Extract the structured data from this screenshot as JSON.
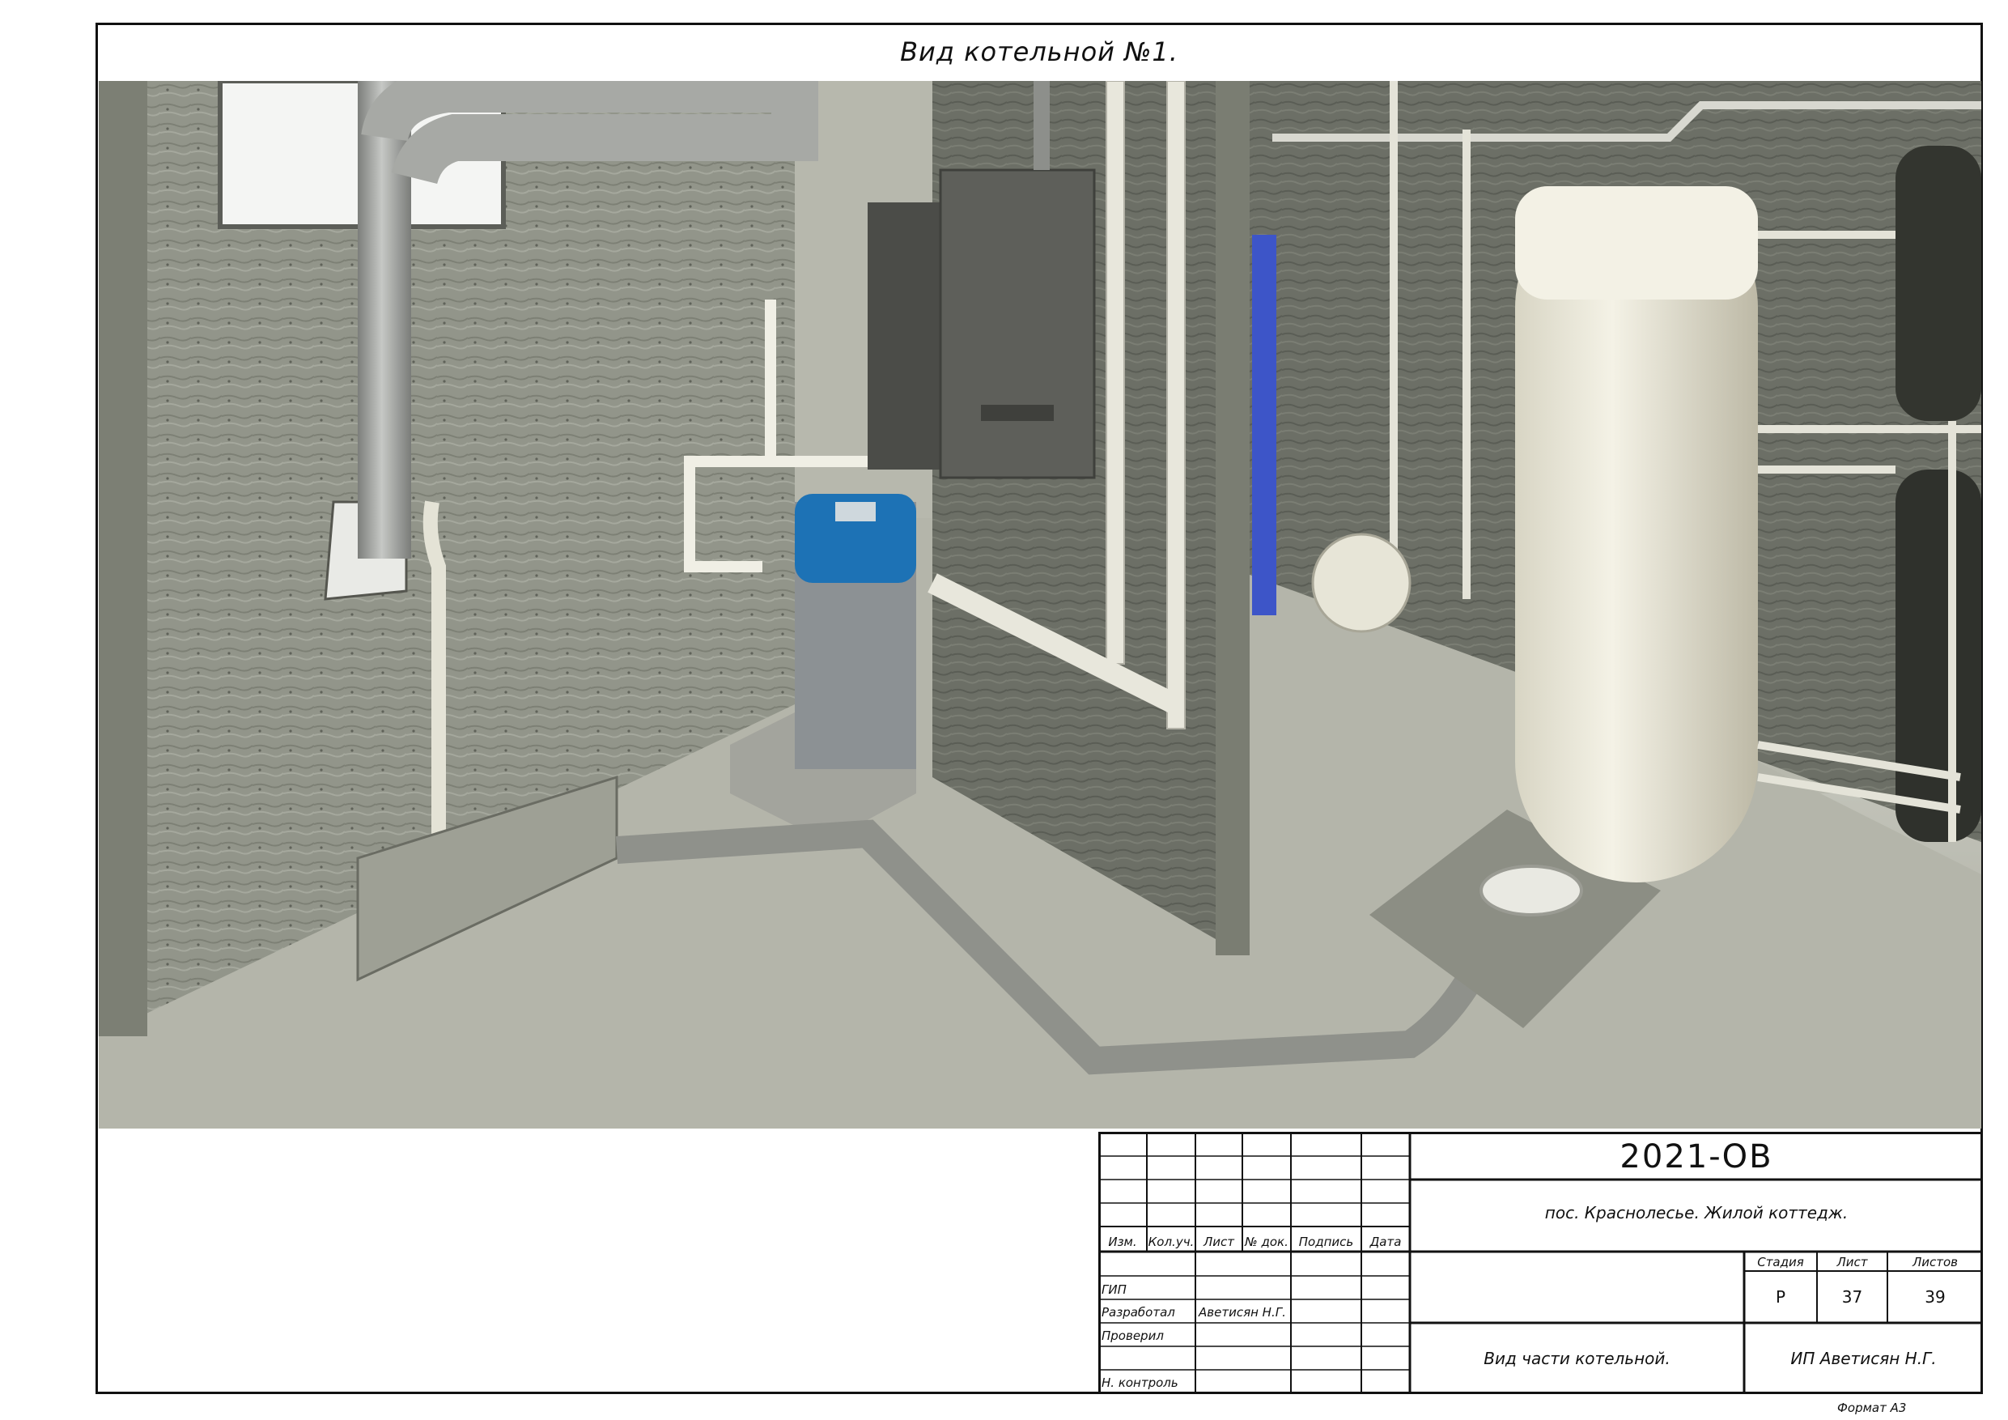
{
  "sheet": {
    "title": "Вид котельной №1.",
    "format_label": "Формат А3"
  },
  "stamp": {
    "document_code": "2021-ОВ",
    "project_name": "пос. Краснолесье. Жилой коттедж.",
    "drawing_name": "Вид части котельной.",
    "organization": "ИП Аветисян Н.Г.",
    "revision_headers": [
      "Изм.",
      "Кол.уч.",
      "Лист",
      "№ док.",
      "Подпись",
      "Дата"
    ],
    "roles": [
      {
        "role": "ГИП",
        "name": ""
      },
      {
        "role": "Разработал",
        "name": "Аветисян Н.Г."
      },
      {
        "role": "Проверил",
        "name": ""
      },
      {
        "role": "",
        "name": ""
      },
      {
        "role": "Н. контроль",
        "name": ""
      }
    ],
    "stage_header": "Стадия",
    "sheet_header": "Лист",
    "sheets_header": "Листов",
    "stage_value": "Р",
    "sheet_value": "37",
    "sheets_value": "39"
  },
  "colors": {
    "wall": "#8f9284",
    "floor": "#b7b8ad",
    "steel_pipe": "#a7a9a5",
    "boiler": "#585955",
    "softener_blue": "#1d72b5",
    "tank_cream": "#e9e6d6",
    "expansion_blue": "#3d55c8"
  }
}
